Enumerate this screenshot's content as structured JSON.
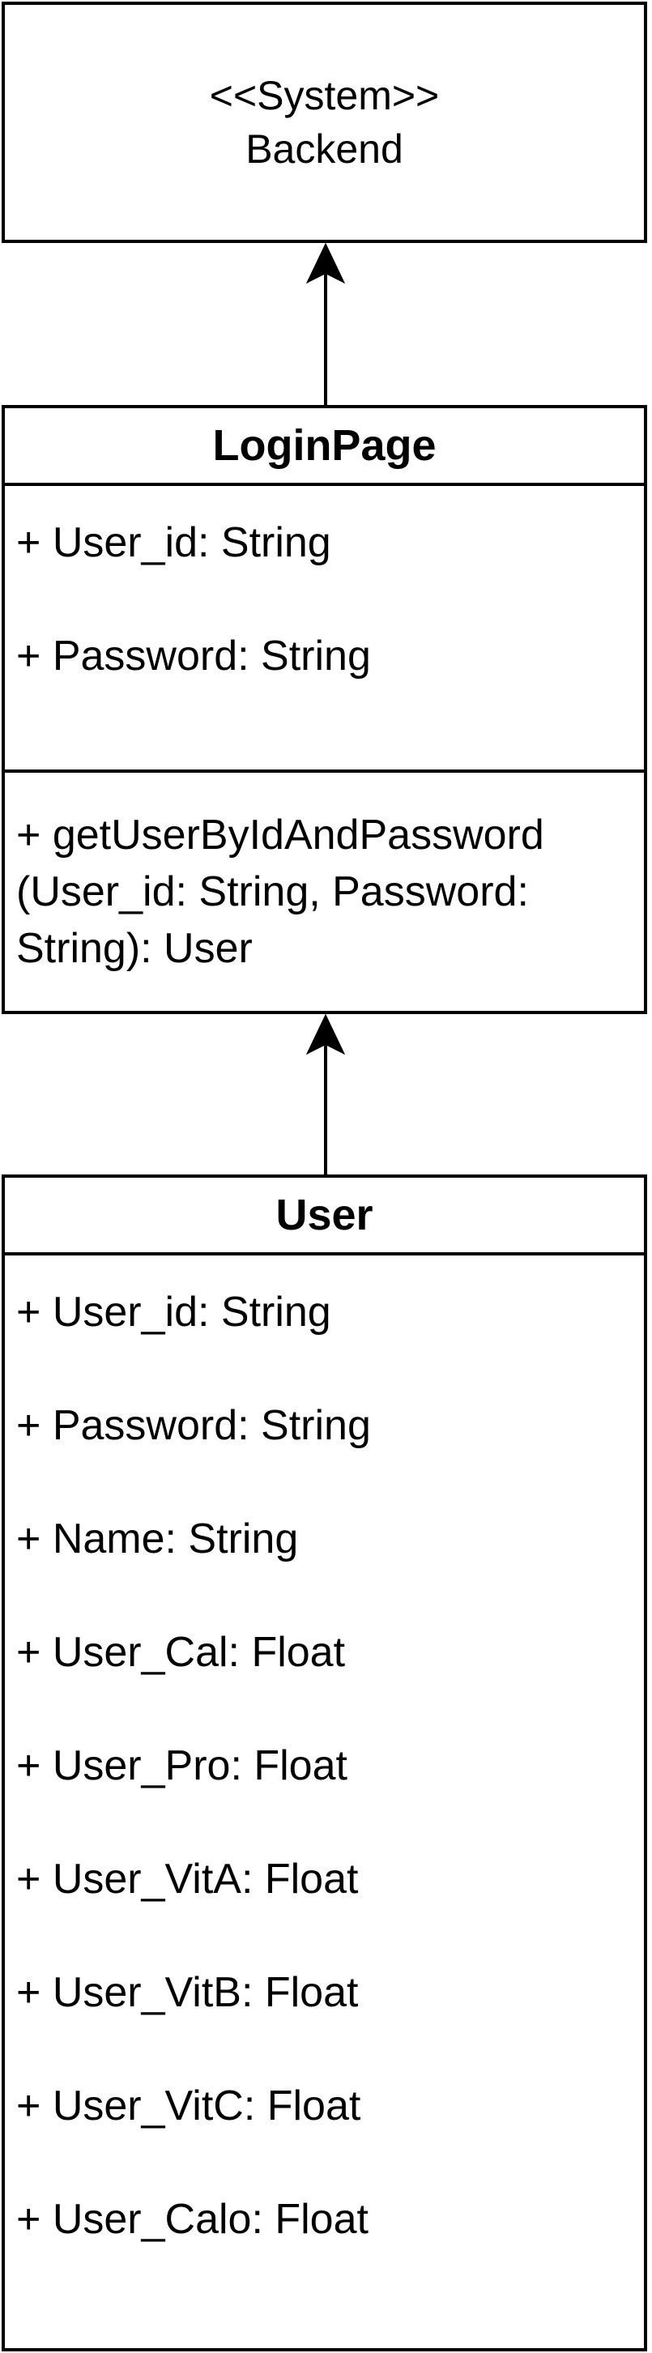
{
  "system": {
    "stereotype": "<<System>>",
    "name": "Backend"
  },
  "login_page": {
    "title": "LoginPage",
    "attributes": [
      "+ User_id: String",
      "+ Password: String"
    ],
    "method_lines": [
      "+ getUserByIdAndPassword",
      "(User_id: String, Password:",
      "String): User"
    ]
  },
  "user": {
    "title": "User",
    "attributes": [
      "+ User_id: String",
      "+ Password: String",
      "+ Name: String",
      "+ User_Cal: Float",
      "+ User_Pro: Float",
      "+ User_VitA: Float",
      "+ User_VitB: Float",
      "+ User_VitC: Float",
      "+ User_Calo: Float"
    ]
  }
}
